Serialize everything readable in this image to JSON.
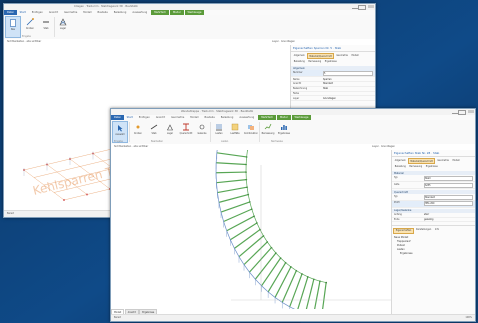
{
  "colors": {
    "desktop": "#0e3f74",
    "brand_blue": "#2a67b1",
    "module_green": "#5b9b3a",
    "model_orange": "#e8a06a",
    "stair_green": "#58a655",
    "stair_blue": "#6c8fc8"
  },
  "back_window": {
    "title": "Cdegen · Treib.mm · Stabtragwerk 3D · BauStatik",
    "menu": [
      "Datei",
      "Start",
      "Einfügen",
      "Ansicht",
      "Geometrie",
      "Modell",
      "Bauteile",
      "Belastung",
      "Auswertung",
      "Mehrfach",
      "Modul",
      "Werkzeuge",
      "Ausgabe",
      "Stabwerk"
    ],
    "ribbon": [
      {
        "label": "Neu",
        "icon": "new-document-icon"
      },
      {
        "label": "Knoten",
        "icon": "node-icon"
      },
      {
        "label": "Stab",
        "icon": "beam-icon"
      },
      {
        "label": "Lager",
        "icon": "support-icon"
      }
    ],
    "ribbon_groups": [
      "Eingabe"
    ],
    "toolbar_left": "Sichtbarkeiten · alle sichtbar",
    "toolbar_right": "Layer · Grundlagen",
    "watermark": "Kehlsparren Traufe re",
    "panel": {
      "title": "Eigenschaften Sparren Nr. 5 · Stab",
      "tabs": [
        "Allgemein",
        "Material/Querschnitt",
        "Geometrie",
        "Modell",
        "Belastung",
        "Bemessung",
        "Ergebnisse"
      ],
      "section_title": "Allgemein",
      "rows": [
        {
          "k": "Nummer",
          "v": "5"
        },
        {
          "k": "Name",
          "v": "Sparren"
        },
        {
          "k": "Ansicht",
          "v": "Standard"
        },
        {
          "k": "Bezeichnung",
          "v": "Stab"
        },
        {
          "k": "Farbe",
          "v": ""
        },
        {
          "k": "Layer",
          "v": "Grundlagen"
        }
      ]
    },
    "status": "Bereit"
  },
  "front_window": {
    "title": "Wendeltreppe · Treib.mm · Stabtragwerk 3D · BauStatik",
    "menu": [
      "Datei",
      "Start",
      "Einfügen",
      "Ansicht",
      "Geometrie",
      "Modell",
      "Bauteile",
      "Belastung",
      "Auswertung",
      "Mehrfach",
      "Modul",
      "Werkzeuge",
      "Ausgabe",
      "Stabwerk"
    ],
    "ribbon": [
      {
        "label": "Auswahl",
        "icon": "select-arrow-icon"
      },
      {
        "label": "Knoten",
        "icon": "node-icon"
      },
      {
        "label": "Stab",
        "icon": "beam-icon"
      },
      {
        "label": "Lager",
        "icon": "support-icon"
      },
      {
        "label": "Querschnitt",
        "icon": "cross-section-icon"
      },
      {
        "label": "Gelenke",
        "icon": "hinge-icon"
      },
      {
        "label": "Lasten",
        "icon": "load-icon"
      },
      {
        "label": "Lastfälle",
        "icon": "loadcase-icon"
      },
      {
        "label": "Kombination",
        "icon": "combination-icon"
      },
      {
        "label": "Bemessung",
        "icon": "design-icon"
      },
      {
        "label": "Ergebnisse",
        "icon": "results-icon"
      }
    ],
    "ribbon_groups": [
      "Eingabe",
      "Bearbeiten",
      "Lasten",
      "Nachweise"
    ],
    "toolbar_left": "Sichtbarkeiten · alle sichtbar",
    "toolbar_right": "Layer · Grundlagen",
    "panel": {
      "title": "Eigenschaften Stab Nr. 28 · Stab",
      "tabs": [
        "Allgemein",
        "Material/Querschnitt",
        "Geometrie",
        "Modell",
        "Belastung",
        "Bemessung",
        "Ergebnisse"
      ],
      "section_title": "Material",
      "rows": [
        {
          "k": "Typ",
          "v": "Stahl"
        },
        {
          "k": "Güte",
          "v": "S235"
        }
      ],
      "section2_title": "Querschnitt",
      "rows2": [
        {
          "k": "Typ",
          "v": "Standard"
        },
        {
          "k": "Profil",
          "v": "HEA 200"
        }
      ],
      "section3_title": "Lager/Gelenke",
      "rows3": [
        {
          "k": "Anfang",
          "v": "starr"
        },
        {
          "k": "Ende",
          "v": "gelenkig"
        }
      ],
      "subtabs": [
        "Eigenschaften",
        "Darstellungen",
        "Info"
      ],
      "tree": [
        {
          "label": "Neue Modell",
          "level": 0
        },
        {
          "label": "Treppenlauf",
          "level": 1
        },
        {
          "label": "Podest",
          "level": 1
        },
        {
          "label": "Lasten",
          "level": 1
        },
        {
          "label": "Ergebnisse",
          "level": 2
        }
      ]
    },
    "bottom_tabs": [
      "Modell",
      "Ansicht",
      "Ergebnisse"
    ],
    "status": "Bereit",
    "status_right": "100%"
  }
}
